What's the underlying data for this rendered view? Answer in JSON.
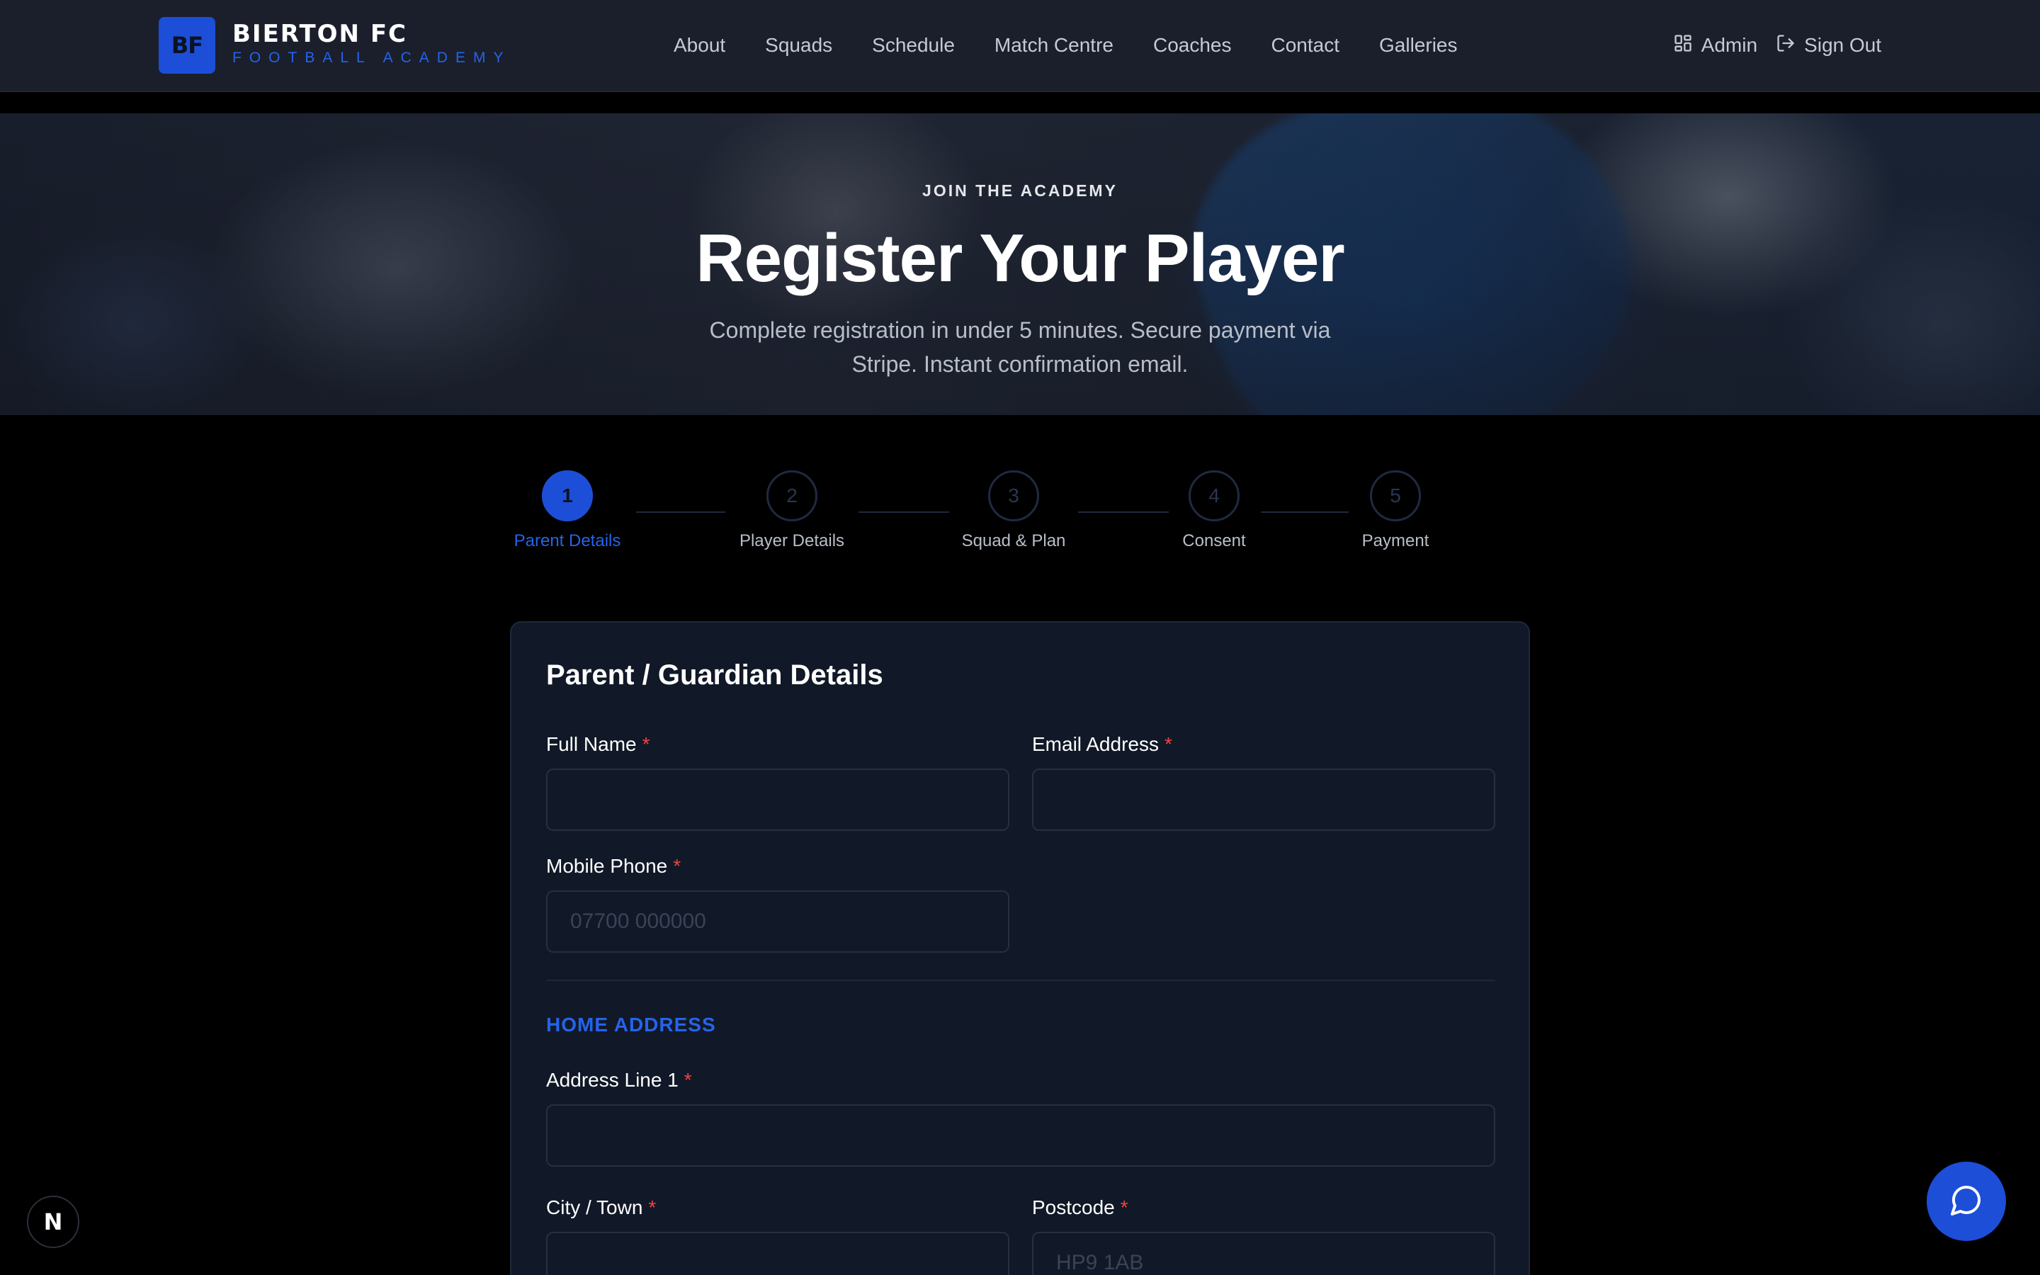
{
  "brand": {
    "logo_initials": "BF",
    "name": "BIERTON FC",
    "subtitle": "FOOTBALL ACADEMY"
  },
  "nav": {
    "items": [
      "About",
      "Squads",
      "Schedule",
      "Match Centre",
      "Coaches",
      "Contact",
      "Galleries"
    ]
  },
  "header_actions": {
    "admin_label": "Admin",
    "admin_icon": "dashboard-icon",
    "signout_label": "Sign Out",
    "signout_icon": "sign-out-icon"
  },
  "hero": {
    "eyebrow": "JOIN THE ACADEMY",
    "title": "Register Your Player",
    "subtitle": "Complete registration in under 5 minutes. Secure payment via Stripe. Instant confirmation email."
  },
  "stepper": {
    "current_step": 1,
    "steps": [
      {
        "number": "1",
        "label": "Parent Details"
      },
      {
        "number": "2",
        "label": "Player Details"
      },
      {
        "number": "3",
        "label": "Squad & Plan"
      },
      {
        "number": "4",
        "label": "Consent"
      },
      {
        "number": "5",
        "label": "Payment"
      }
    ]
  },
  "form": {
    "title": "Parent / Guardian Details",
    "required_marker": "*",
    "full_name": {
      "label": "Full Name",
      "value": "",
      "placeholder": ""
    },
    "email": {
      "label": "Email Address",
      "value": "",
      "placeholder": ""
    },
    "mobile": {
      "label": "Mobile Phone",
      "value": "",
      "placeholder": "07700 000000"
    },
    "address_section": "HOME ADDRESS",
    "address_line1": {
      "label": "Address Line 1",
      "value": "",
      "placeholder": ""
    },
    "city": {
      "label": "City / Town",
      "value": "",
      "placeholder": ""
    },
    "postcode": {
      "label": "Postcode",
      "value": "",
      "placeholder": "HP9 1AB"
    }
  },
  "floating": {
    "dev_badge": "N",
    "chat_icon": "chat-bubble-icon"
  },
  "colors": {
    "accent": "#1d4ed8",
    "accent_text": "#2563eb",
    "required": "#ef4444",
    "header_bg": "#1a1f2b",
    "card_bg": "#111827",
    "page_bg": "#000000"
  }
}
